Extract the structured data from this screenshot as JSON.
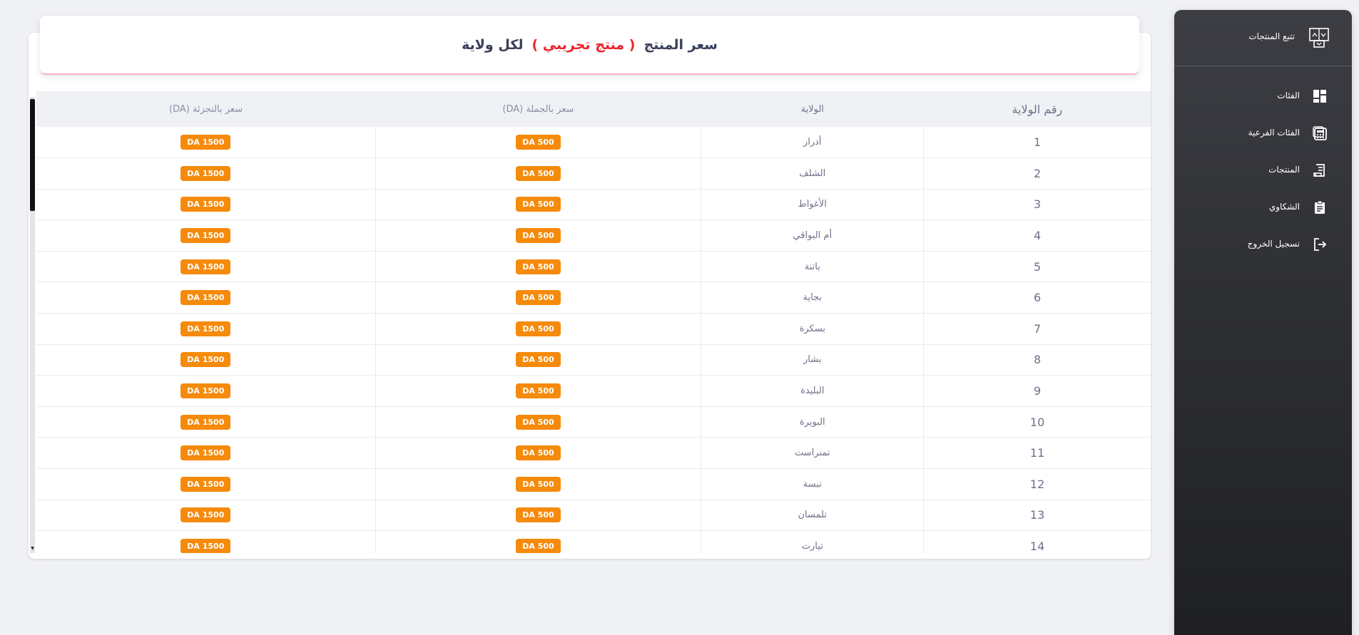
{
  "sidebar": {
    "brand_title": "تتبع المنتجات",
    "items": [
      {
        "label": "الفئات",
        "icon": "dashboard-icon"
      },
      {
        "label": "الفئات الفرعية",
        "icon": "calculator-icon"
      },
      {
        "label": "المنتجات",
        "icon": "receipt-icon"
      },
      {
        "label": "الشكاوي",
        "icon": "clipboard-icon"
      },
      {
        "label": "تسجيل الخروج",
        "icon": "logout-icon"
      }
    ]
  },
  "header": {
    "title_prefix": "سعر المنتج",
    "product_name": "( منتج تجريبي )",
    "title_suffix": "لكل ولاية"
  },
  "table": {
    "columns": [
      "رقم الولاية",
      "الولاية",
      "سعر بالجملة (DA)",
      "سعر بالتجزئة (DA)"
    ],
    "rows": [
      {
        "num": "1",
        "wilaya": "أدرار",
        "wholesale": "DA 500",
        "retail": "DA 1500"
      },
      {
        "num": "2",
        "wilaya": "الشلف",
        "wholesale": "DA 500",
        "retail": "DA 1500"
      },
      {
        "num": "3",
        "wilaya": "الأغواط",
        "wholesale": "DA 500",
        "retail": "DA 1500"
      },
      {
        "num": "4",
        "wilaya": "أم البواقي",
        "wholesale": "DA 500",
        "retail": "DA 1500"
      },
      {
        "num": "5",
        "wilaya": "باتنة",
        "wholesale": "DA 500",
        "retail": "DA 1500"
      },
      {
        "num": "6",
        "wilaya": "بجاية",
        "wholesale": "DA 500",
        "retail": "DA 1500"
      },
      {
        "num": "7",
        "wilaya": "بسكرة",
        "wholesale": "DA 500",
        "retail": "DA 1500"
      },
      {
        "num": "8",
        "wilaya": "بشار",
        "wholesale": "DA 500",
        "retail": "DA 1500"
      },
      {
        "num": "9",
        "wilaya": "البليدة",
        "wholesale": "DA 500",
        "retail": "DA 1500"
      },
      {
        "num": "10",
        "wilaya": "البويرة",
        "wholesale": "DA 500",
        "retail": "DA 1500"
      },
      {
        "num": "11",
        "wilaya": "تمنراست",
        "wholesale": "DA 500",
        "retail": "DA 1500"
      },
      {
        "num": "12",
        "wilaya": "تبسة",
        "wholesale": "DA 500",
        "retail": "DA 1500"
      },
      {
        "num": "13",
        "wilaya": "تلمسان",
        "wholesale": "DA 500",
        "retail": "DA 1500"
      },
      {
        "num": "14",
        "wilaya": "تيارت",
        "wholesale": "DA 500",
        "retail": "DA 1500"
      }
    ]
  },
  "colors": {
    "accent_orange": "#f58a0b",
    "product_red": "#e8252d",
    "title_navy": "#3a3f5c",
    "sidebar_dark": "#2f3034"
  }
}
